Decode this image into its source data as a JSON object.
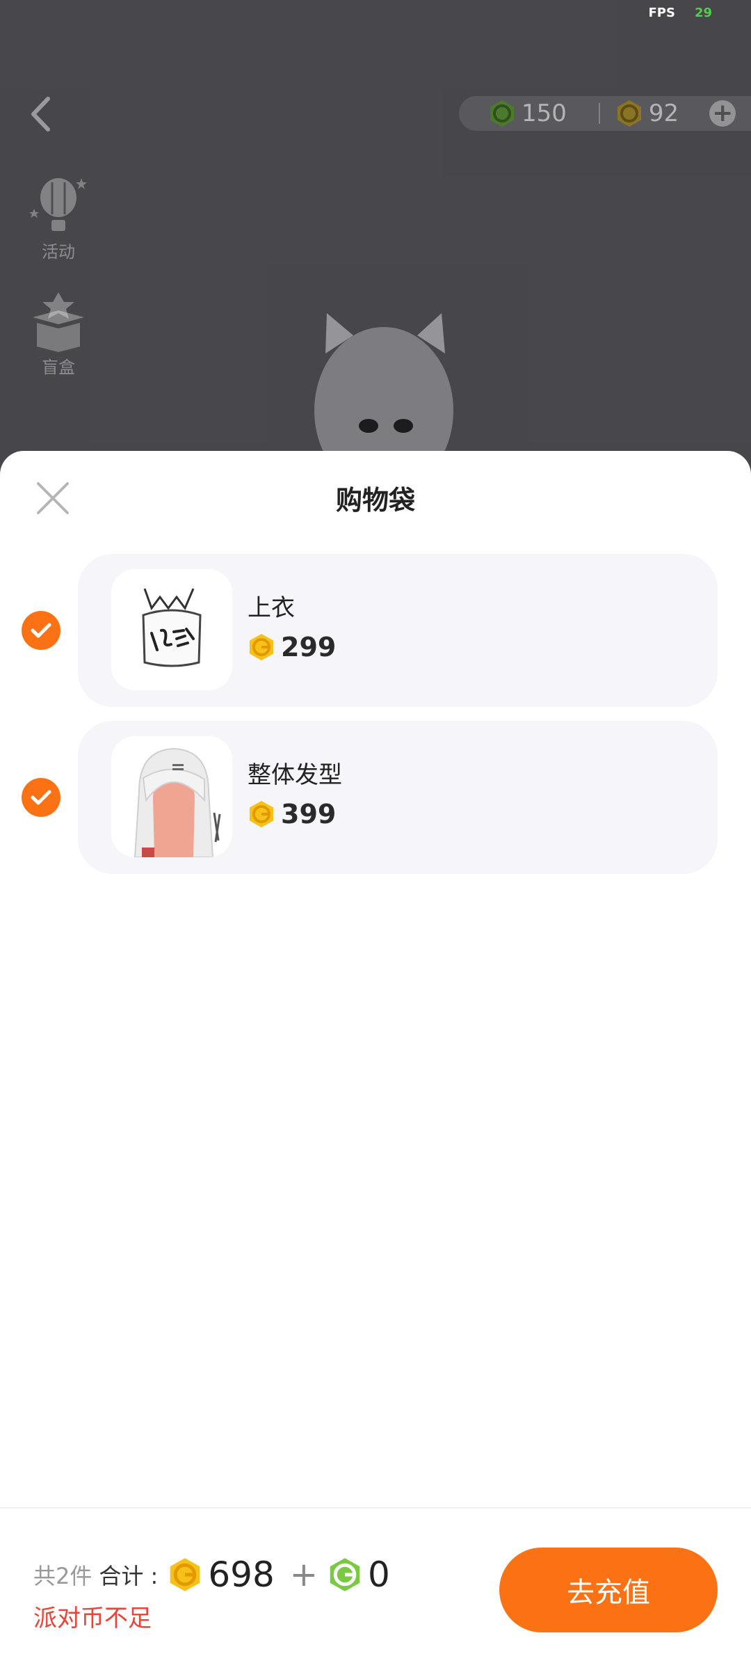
{
  "status": {
    "fps_label": "FPS",
    "fps_value": "29"
  },
  "header": {
    "green_coin_balance": "150",
    "gold_coin_balance": "92"
  },
  "side_menu": [
    {
      "label": "活动",
      "icon": "hot-air-balloon-icon"
    },
    {
      "label": "盲盒",
      "icon": "mystery-box-icon"
    }
  ],
  "sheet": {
    "title": "购物袋",
    "items": [
      {
        "name": "上衣",
        "price": "299",
        "checked": true,
        "thumb": "tank-top-image"
      },
      {
        "name": "整体发型",
        "price": "399",
        "checked": true,
        "thumb": "hairstyle-image"
      }
    ]
  },
  "footer": {
    "count_text": "共2件",
    "total_label": "合计 :",
    "gold_total": "698",
    "plus_sign": "+",
    "green_total": "0",
    "warning": "派对币不足",
    "recharge_label": "去充值"
  },
  "colors": {
    "accent": "#fb7214",
    "warning": "#e84438",
    "gold_coin": "#f6c21a",
    "green_coin": "#7ac943"
  }
}
